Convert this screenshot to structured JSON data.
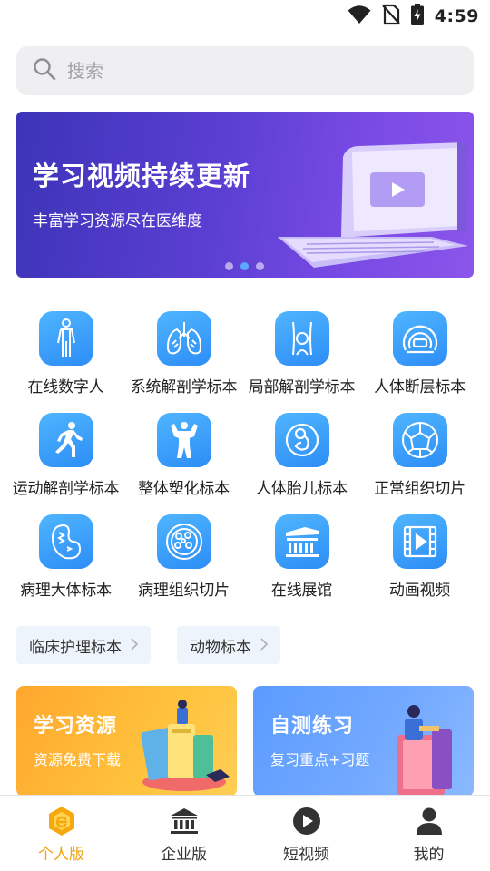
{
  "status_bar": {
    "time": "4:59",
    "icons": [
      "wifi-icon",
      "no-sim-icon",
      "battery-charging-icon"
    ]
  },
  "search": {
    "placeholder": "搜索",
    "icon": "search-icon"
  },
  "banner": {
    "title": "学习视频持续更新",
    "subtitle": "丰富学习资源尽在医维度",
    "page_count": 3,
    "active_page": 2
  },
  "grid": {
    "items": [
      {
        "label": "在线数字人",
        "icon": "human-body-icon"
      },
      {
        "label": "系统解剖学标本",
        "icon": "lungs-icon"
      },
      {
        "label": "局部解剖学标本",
        "icon": "torso-icon"
      },
      {
        "label": "人体断层标本",
        "icon": "ct-scan-icon"
      },
      {
        "label": "运动解剖学标本",
        "icon": "runner-icon"
      },
      {
        "label": "整体塑化标本",
        "icon": "muscle-figure-icon"
      },
      {
        "label": "人体胎儿标本",
        "icon": "fetus-icon"
      },
      {
        "label": "正常组织切片",
        "icon": "tissue-cells-icon"
      },
      {
        "label": "病理大体标本",
        "icon": "kidney-icon"
      },
      {
        "label": "病理组织切片",
        "icon": "cell-slice-icon"
      },
      {
        "label": "在线展馆",
        "icon": "museum-icon"
      },
      {
        "label": "动画视频",
        "icon": "film-play-icon"
      }
    ]
  },
  "chips": [
    {
      "label": "临床护理标本",
      "icon": "chevron-right-icon"
    },
    {
      "label": "动物标本",
      "icon": "chevron-right-icon"
    }
  ],
  "cards": [
    {
      "title": "学习资源",
      "subtitle": "资源免费下载",
      "color": "#ffb534"
    },
    {
      "title": "自测练习",
      "subtitle": "复习重点+习题",
      "color": "#6aa4ff"
    }
  ],
  "tabbar": {
    "tabs": [
      {
        "label": "个人版",
        "icon": "personal-edition-icon",
        "active": true
      },
      {
        "label": "企业版",
        "icon": "bank-building-icon",
        "active": false
      },
      {
        "label": "短视频",
        "icon": "play-circle-icon",
        "active": false
      },
      {
        "label": "我的",
        "icon": "user-icon",
        "active": false
      }
    ],
    "active_color": "#f0a312"
  }
}
